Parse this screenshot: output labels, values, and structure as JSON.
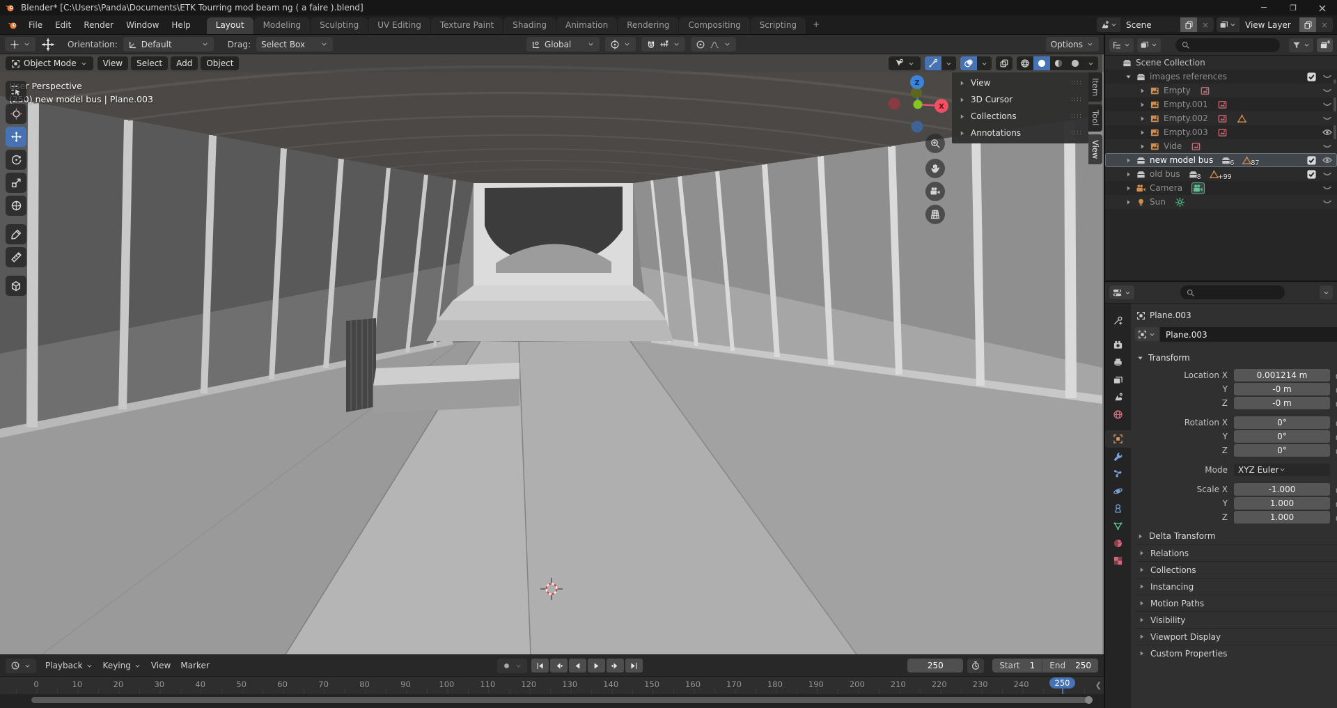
{
  "window": {
    "title": "Blender* [C:\\Users\\Panda\\Documents\\ETK Tourring mod beam ng ( a faire ).blend]",
    "controls": [
      "minimize",
      "maximize",
      "close"
    ]
  },
  "topbar": {
    "menus": [
      "File",
      "Edit",
      "Render",
      "Window",
      "Help"
    ],
    "workspaces": [
      "Layout",
      "Modeling",
      "Sculpting",
      "UV Editing",
      "Texture Paint",
      "Shading",
      "Animation",
      "Rendering",
      "Compositing",
      "Scripting"
    ],
    "active_workspace": "Layout",
    "add_workspace": "+",
    "scene_label": "Scene",
    "view_layer_label": "View Layer"
  },
  "tool_header": {
    "orientation_label": "Orientation:",
    "orientation_value": "Default",
    "drag_label": "Drag:",
    "drag_value": "Select Box",
    "transform_orientation": "Global",
    "options_label": "Options"
  },
  "viewport": {
    "mode": "Object Mode",
    "menus": [
      "View",
      "Select",
      "Add",
      "Object"
    ],
    "overlay_line1": "User Perspective",
    "overlay_line2": "(250) new model bus | Plane.003",
    "tools": [
      {
        "name": "select-box"
      },
      {
        "name": "cursor"
      },
      {
        "name": "move",
        "active": true
      },
      {
        "name": "rotate"
      },
      {
        "name": "scale"
      },
      {
        "name": "transform"
      },
      {
        "name": "annotate",
        "gap": true
      },
      {
        "name": "measure"
      },
      {
        "name": "add-cube",
        "gap": true
      }
    ],
    "npanel_sections": [
      "View",
      "3D Cursor",
      "Collections",
      "Annotations"
    ],
    "sidebar_tabs": [
      "Item",
      "Tool",
      "View"
    ],
    "active_sidebar_tab": "View",
    "axis_x": "X",
    "axis_z": "Z",
    "nav_buttons": [
      "zoom",
      "pan",
      "camera",
      "ortho"
    ]
  },
  "outliner": {
    "rows": [
      {
        "indent": 0,
        "icon": "collection",
        "label": "Scene Collection"
      },
      {
        "indent": 1,
        "expand": "down",
        "icon": "collection",
        "label": "images references",
        "checkbox": true,
        "eye": "closed",
        "dim": true
      },
      {
        "indent": 2,
        "expand": "right",
        "icon": "empty-image",
        "label": "Empty",
        "extras": [
          "image-data"
        ],
        "eye": "closed",
        "dim": true
      },
      {
        "indent": 2,
        "expand": "right",
        "icon": "empty-image",
        "label": "Empty.001",
        "extras": [
          "image-data"
        ],
        "eye": "closed",
        "dim": true
      },
      {
        "indent": 2,
        "expand": "right",
        "icon": "empty-image",
        "label": "Empty.002",
        "extras": [
          "image-data",
          "mesh-tri"
        ],
        "eye": "closed",
        "dim": true
      },
      {
        "indent": 2,
        "expand": "right",
        "icon": "empty-image",
        "label": "Empty.003",
        "extras": [
          "image-data"
        ],
        "eye": "open",
        "dim": true
      },
      {
        "indent": 2,
        "expand": "right",
        "icon": "empty-image",
        "label": "Vide",
        "extras": [
          "image-data"
        ],
        "eye": "closed",
        "dim": true
      },
      {
        "indent": 1,
        "expand": "right",
        "icon": "collection",
        "label": "new model bus",
        "selected": true,
        "badges": [
          {
            "icon": "collection",
            "count": "6"
          },
          {
            "icon": "mesh-tri",
            "count": "87"
          }
        ],
        "checkbox": true,
        "eye": "open"
      },
      {
        "indent": 1,
        "expand": "right",
        "icon": "collection",
        "label": "old bus",
        "badges": [
          {
            "icon": "collection",
            "count": "8"
          },
          {
            "icon": "mesh-tri",
            "count": "+99"
          }
        ],
        "checkbox": true,
        "eye": "closed",
        "dim": true
      },
      {
        "indent": 1,
        "expand": "right",
        "icon": "camera",
        "label": "Camera",
        "extras": [
          "camera-data"
        ],
        "eye": "closed",
        "dim": true
      },
      {
        "indent": 1,
        "expand": "right",
        "icon": "light",
        "label": "Sun",
        "extras": [
          "sun-data"
        ],
        "eye": "closed",
        "dim": true
      }
    ]
  },
  "properties": {
    "tabs": [
      {
        "name": "tool"
      },
      {
        "name": "render",
        "gap": true
      },
      {
        "name": "output"
      },
      {
        "name": "view-layer"
      },
      {
        "name": "scene"
      },
      {
        "name": "world"
      },
      {
        "name": "object",
        "gap": true,
        "active": true
      },
      {
        "name": "modifiers"
      },
      {
        "name": "particles"
      },
      {
        "name": "physics"
      },
      {
        "name": "constraints"
      },
      {
        "name": "data"
      },
      {
        "name": "material"
      },
      {
        "name": "texture"
      }
    ],
    "breadcrumb": "Plane.003",
    "name_value": "Plane.003",
    "transform": {
      "title": "Transform",
      "groups": [
        [
          [
            "Location X",
            "0.001214 m"
          ],
          [
            "Y",
            "-0 m"
          ],
          [
            "Z",
            "-0 m"
          ]
        ],
        [
          [
            "Rotation X",
            "0°"
          ],
          [
            "Y",
            "0°"
          ],
          [
            "Z",
            "0°"
          ]
        ]
      ],
      "mode_label": "Mode",
      "mode_value": "XYZ Euler",
      "scale": [
        [
          "Scale X",
          "-1.000"
        ],
        [
          "Y",
          "1.000"
        ],
        [
          "Z",
          "1.000"
        ]
      ],
      "delta": "Delta Transform"
    },
    "sections": [
      "Relations",
      "Collections",
      "Instancing",
      "Motion Paths",
      "Visibility",
      "Viewport Display",
      "Custom Properties"
    ]
  },
  "timeline": {
    "menus": [
      {
        "label": "Playback",
        "chev": true
      },
      {
        "label": "Keying",
        "chev": true
      },
      {
        "label": "View"
      },
      {
        "label": "Marker"
      }
    ],
    "playback_buttons": [
      "jump-start",
      "prev-key",
      "play-back",
      "play",
      "next-key",
      "jump-end"
    ],
    "current_frame": "250",
    "start_label": "Start",
    "start_value": "1",
    "end_label": "End",
    "end_value": "250",
    "ticks": [
      0,
      10,
      20,
      30,
      40,
      50,
      60,
      70,
      80,
      90,
      100,
      110,
      120,
      130,
      140,
      150,
      160,
      170,
      180,
      190,
      200,
      210,
      220,
      230,
      240,
      250
    ],
    "active_tick": 250
  }
}
